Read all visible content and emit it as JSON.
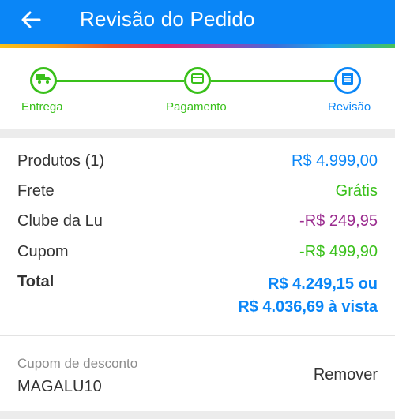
{
  "header": {
    "title": "Revisão do Pedido",
    "back_icon": "arrow-left-icon",
    "background": "#0a86f7"
  },
  "stepper": {
    "steps": [
      {
        "label": "Entrega",
        "icon": "truck-icon",
        "state": "done"
      },
      {
        "label": "Pagamento",
        "icon": "credit-card-icon",
        "state": "done"
      },
      {
        "label": "Revisão",
        "icon": "document-list-icon",
        "state": "active"
      }
    ],
    "done_color": "#39c01a",
    "active_color": "#0a86f7"
  },
  "summary": {
    "products_label": "Produtos (1)",
    "products_value": "R$ 4.999,00",
    "shipping_label": "Frete",
    "shipping_value": "Grátis",
    "club_label": "Clube da Lu",
    "club_value": "-R$ 249,95",
    "coupon_label": "Cupom",
    "coupon_value": "-R$ 499,90",
    "total_label": "Total",
    "total_value_line1": "R$ 4.249,15 ou",
    "total_value_line2": "R$ 4.036,69 à vista"
  },
  "coupon_box": {
    "label": "Cupom de desconto",
    "code": "MAGALU10",
    "remove_label": "Remover"
  }
}
